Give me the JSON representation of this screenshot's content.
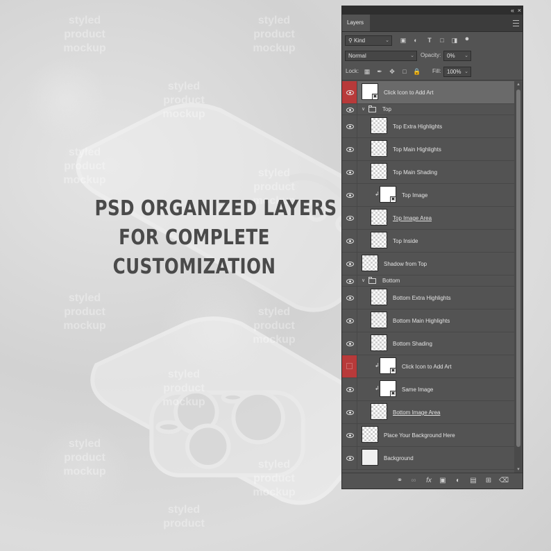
{
  "background": {
    "watermark": [
      "styled",
      "product",
      "mockup"
    ]
  },
  "headline": {
    "line1": "PSD ORGANIZED LAYERS",
    "line2": "FOR COMPLETE",
    "line3": "CUSTOMIZATION"
  },
  "panel": {
    "title": "Layers",
    "collapse_glyph": "«",
    "close_glyph": "×",
    "filter": {
      "kind_label": "Kind"
    },
    "blend_mode": "Normal",
    "opacity_label": "Opacity:",
    "opacity_value": "0%",
    "lock_label": "Lock:",
    "fill_label": "Fill:",
    "fill_value": "100%"
  },
  "layers": [
    {
      "name": "Click Icon to Add Art",
      "type": "smart",
      "indent": 0,
      "eye": "red-eye",
      "selected": true
    },
    {
      "name": "Top",
      "type": "group",
      "indent": 0,
      "eye": "eye"
    },
    {
      "name": "Top Extra Highlights",
      "type": "layer",
      "indent": 1,
      "eye": "eye"
    },
    {
      "name": "Top Main Highlights",
      "type": "layer",
      "indent": 1,
      "eye": "eye"
    },
    {
      "name": "Top Main Shading",
      "type": "layer",
      "indent": 1,
      "eye": "eye"
    },
    {
      "name": "Top Image",
      "type": "smart",
      "indent": 1,
      "clipped": true,
      "eye": "eye"
    },
    {
      "name": "Top Image Area",
      "type": "layer",
      "indent": 1,
      "link": true,
      "eye": "eye"
    },
    {
      "name": "Top Inside",
      "type": "layer",
      "indent": 1,
      "eye": "eye"
    },
    {
      "name": "Shadow from Top",
      "type": "layer",
      "indent": 0,
      "eye": "eye"
    },
    {
      "name": "Bottom",
      "type": "group",
      "indent": 0,
      "eye": "eye"
    },
    {
      "name": "Bottom Extra Highlights",
      "type": "layer",
      "indent": 1,
      "eye": "eye"
    },
    {
      "name": "Bottom Main Highlights",
      "type": "layer",
      "indent": 1,
      "eye": "eye"
    },
    {
      "name": "Bottom Shading",
      "type": "layer",
      "indent": 1,
      "eye": "eye"
    },
    {
      "name": "Click Icon to Add Art",
      "type": "smart",
      "indent": 1,
      "clipped": true,
      "eye": "red-hidden"
    },
    {
      "name": "Same  Image",
      "type": "smart",
      "indent": 1,
      "clipped": true,
      "eye": "eye"
    },
    {
      "name": "Bottom Image Area",
      "type": "layer",
      "indent": 1,
      "link": true,
      "eye": "eye"
    },
    {
      "name": "Place Your Background Here",
      "type": "layer",
      "indent": 0,
      "eye": "eye"
    },
    {
      "name": "Background",
      "type": "plain",
      "indent": 0,
      "eye": "eye"
    }
  ],
  "footer_icons": [
    "link-icon",
    "fx-icon",
    "mask-icon",
    "adjustment-icon",
    "folder-icon",
    "new-layer-icon",
    "trash-icon"
  ]
}
